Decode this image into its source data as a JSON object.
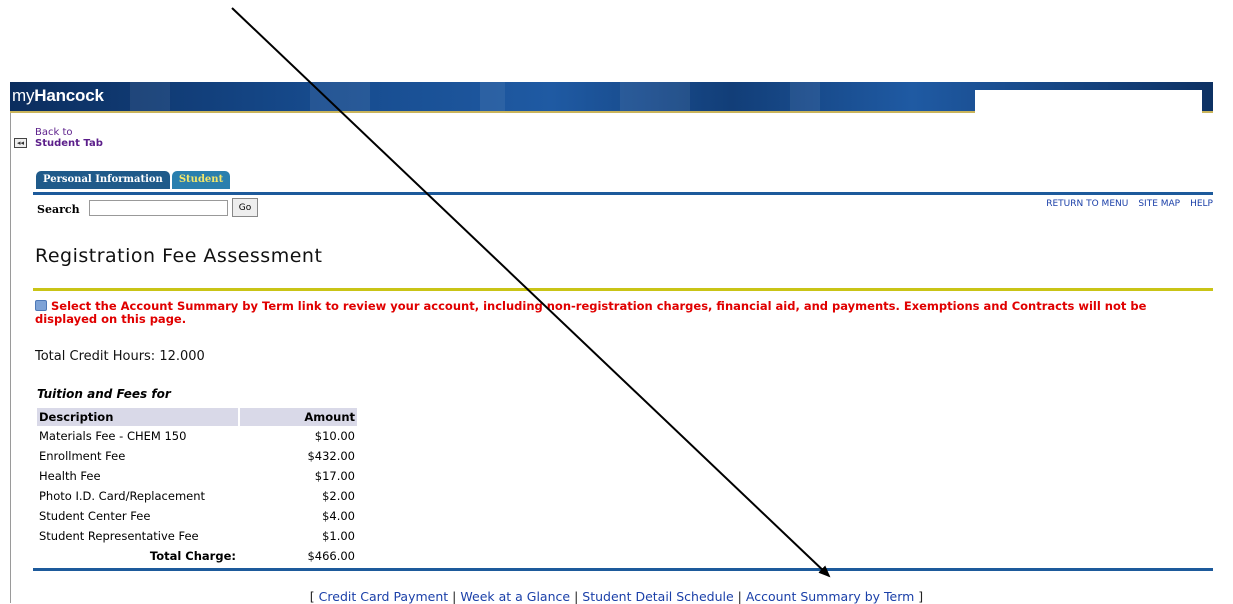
{
  "banner": {
    "logo_prefix": "my",
    "logo_bold": "Hancock"
  },
  "back": {
    "line1": "Back to",
    "line2": "Student Tab",
    "icon": "back-arrow-icon"
  },
  "tabs": [
    {
      "label": "Personal Information"
    },
    {
      "label": "Student"
    }
  ],
  "search": {
    "label": "Search",
    "value": "",
    "go_label": "Go"
  },
  "toplinks": {
    "return": "RETURN TO MENU",
    "sitemap": "SITE MAP",
    "help": "HELP"
  },
  "page": {
    "title": "Registration Fee Assessment",
    "info": "Select the Account Summary by Term link to review your account, including non-registration charges, financial aid, and payments. Exemptions and Contracts will not be displayed on this page.",
    "credit_hours": "Total Credit Hours: 12.000",
    "fees_heading": "Tuition and Fees for"
  },
  "fees": {
    "headers": {
      "description": "Description",
      "amount": "Amount"
    },
    "rows": [
      {
        "description": "Materials Fee - CHEM 150",
        "amount": "$10.00"
      },
      {
        "description": "Enrollment Fee",
        "amount": "$432.00"
      },
      {
        "description": "Health Fee",
        "amount": "$17.00"
      },
      {
        "description": "Photo I.D. Card/Replacement",
        "amount": "$2.00"
      },
      {
        "description": "Student Center Fee",
        "amount": "$4.00"
      },
      {
        "description": "Student Representative Fee",
        "amount": "$1.00"
      }
    ],
    "total_label": "Total Charge:",
    "total_amount": "$466.00"
  },
  "bottom_links": {
    "open": "[",
    "sep": "|",
    "close": "]",
    "credit_card": "Credit Card Payment",
    "week": "Week at a Glance",
    "schedule": "Student Detail Schedule",
    "account": "Account Summary by Term"
  },
  "colors": {
    "banner": "#164a8c",
    "tab_line": "#1d5a9b",
    "info_text": "#e00000",
    "link": "#1a3fa8",
    "yellow_rule": "#c9c416"
  }
}
